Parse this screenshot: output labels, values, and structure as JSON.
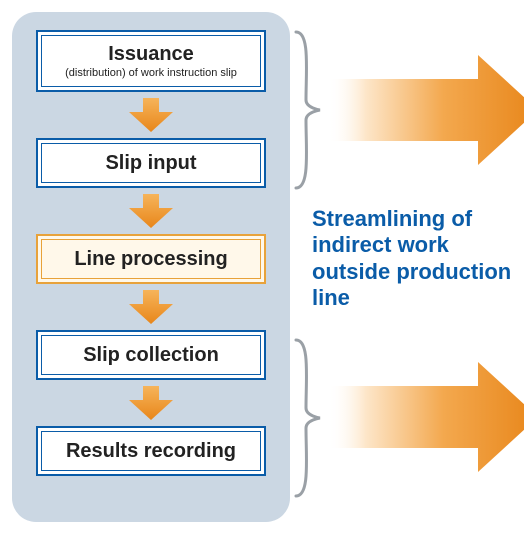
{
  "flow": {
    "box1": {
      "title": "Issuance",
      "sub": "(distribution) of work instruction slip"
    },
    "box2": {
      "title": "Slip input"
    },
    "box3": {
      "title": "Line processing"
    },
    "box4": {
      "title": "Slip collection"
    },
    "box5": {
      "title": "Results recording"
    }
  },
  "caption": "Streamlining of indirect work outside production line",
  "colors": {
    "panel_bg": "#cbd7e3",
    "box_border": "#0a5ca8",
    "highlight_border": "#e8a23a",
    "arrow_start": "#fef3e6",
    "arrow_end": "#e8861a",
    "brace": "#9aa0a6",
    "caption": "#0a5ca8"
  }
}
